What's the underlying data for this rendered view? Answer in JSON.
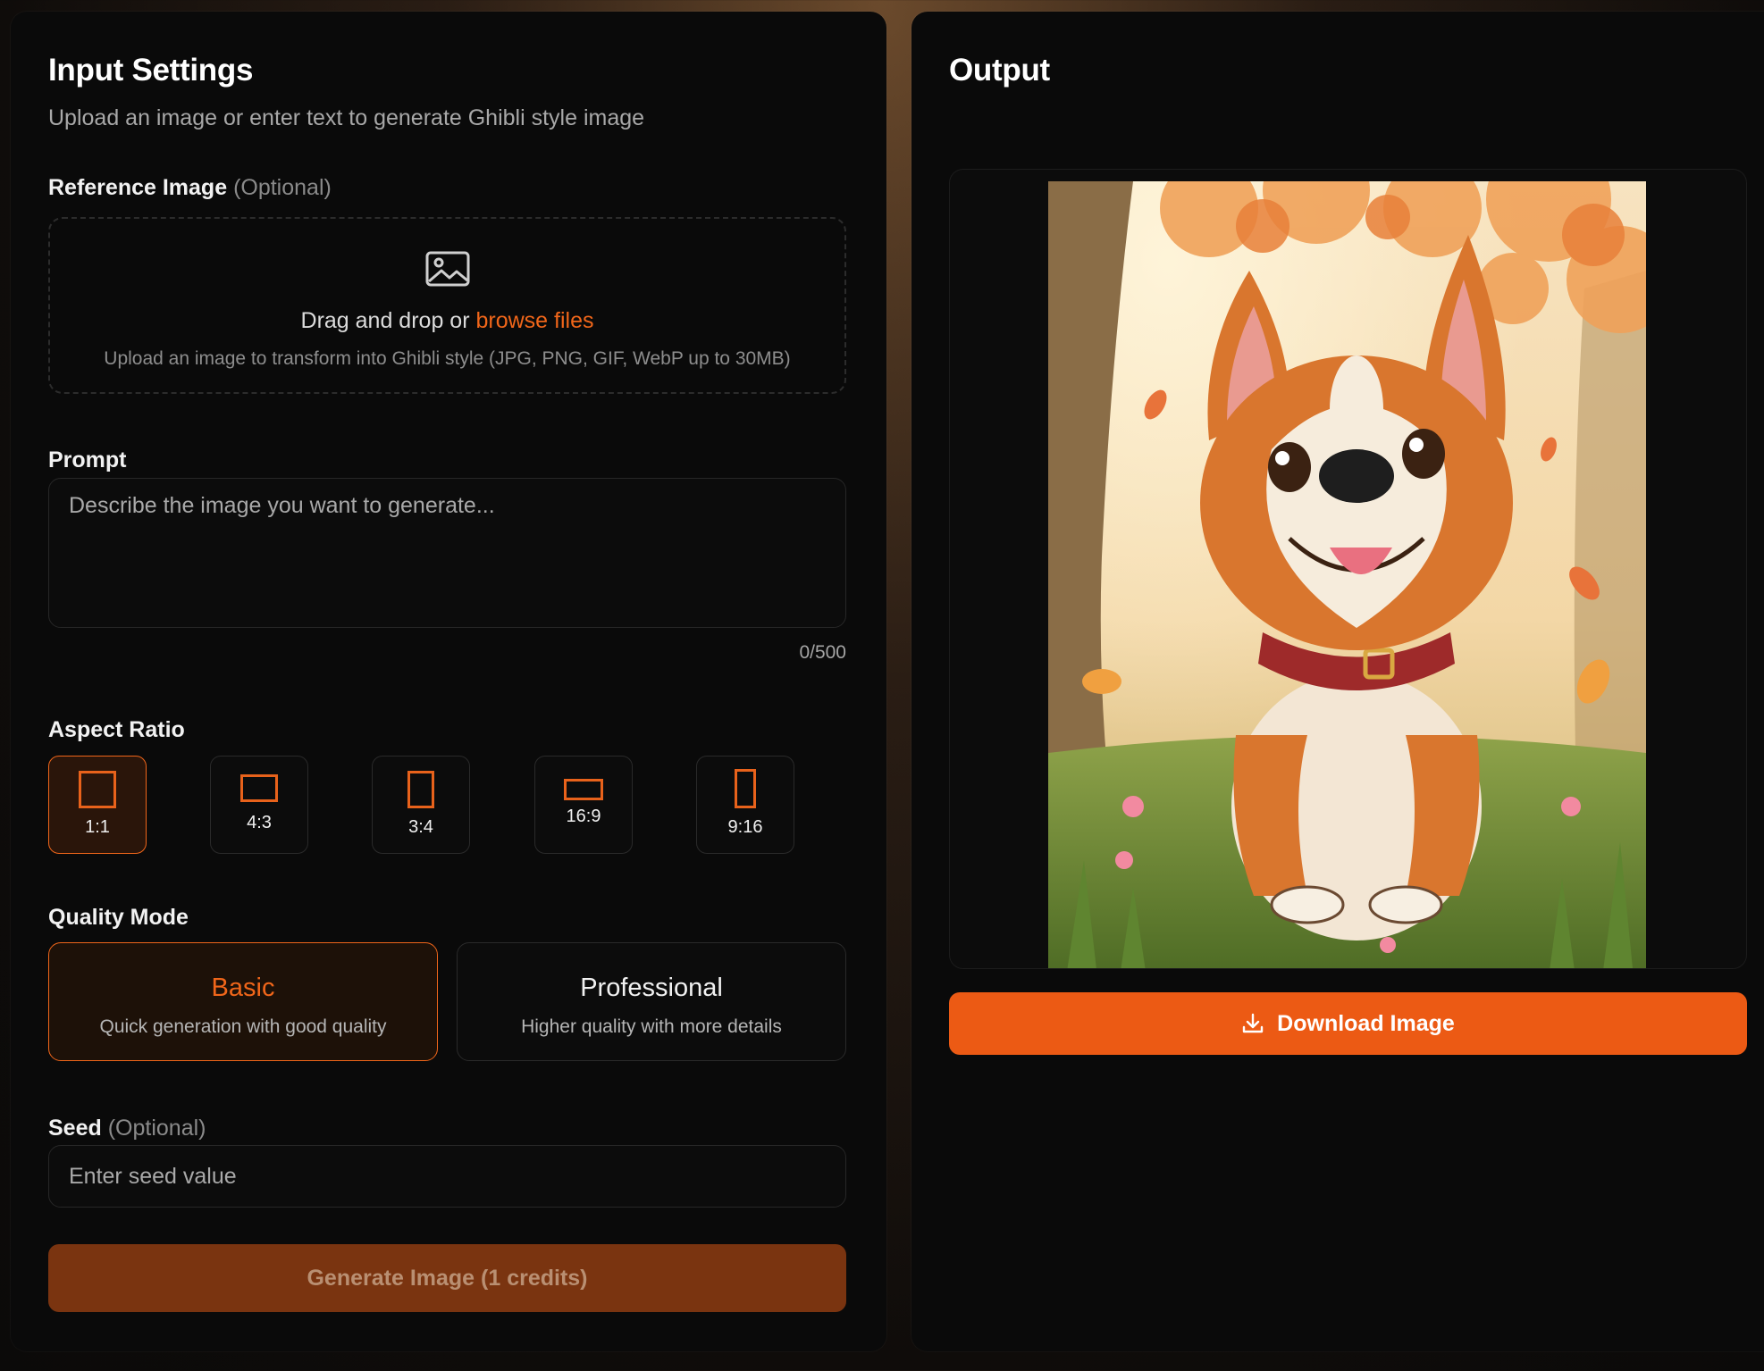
{
  "input_settings": {
    "title": "Input Settings",
    "subtitle": "Upload an image or enter text to generate Ghibli style image",
    "reference": {
      "label": "Reference Image",
      "optional": "(Optional)",
      "drop_text": "Drag and drop or",
      "browse_link": "browse files",
      "hint": "Upload an image to transform into Ghibli style (JPG, PNG, GIF, WebP up to 30MB)",
      "icon": "image-icon"
    },
    "prompt": {
      "label": "Prompt",
      "placeholder": "Describe the image you want to generate...",
      "value": "",
      "counter": "0/500"
    },
    "aspect_ratio": {
      "label": "Aspect Ratio",
      "selected": "1:1",
      "options": [
        "1:1",
        "4:3",
        "3:4",
        "16:9",
        "9:16"
      ]
    },
    "quality_mode": {
      "label": "Quality Mode",
      "selected": "Basic",
      "options": [
        {
          "title": "Basic",
          "description": "Quick generation with good quality"
        },
        {
          "title": "Professional",
          "description": "Higher quality with more details"
        }
      ]
    },
    "seed": {
      "label": "Seed",
      "optional": "(Optional)",
      "placeholder": "Enter seed value",
      "value": ""
    },
    "generate_button": "Generate Image (1 credits)"
  },
  "output": {
    "title": "Output",
    "image_alt": "Ghibli style corgi puppy sitting in autumn forest",
    "download_button": "Download Image",
    "download_icon": "download-icon"
  },
  "colors": {
    "accent": "#F0661A",
    "panel": "#0A0A0A",
    "generate_disabled": "#7A3410"
  }
}
